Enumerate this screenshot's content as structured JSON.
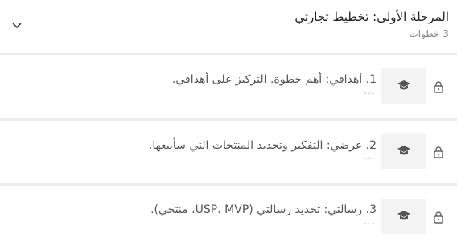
{
  "module": {
    "title": "المرحلة الأولى: تخطيط تجارتي",
    "steps_count": "3 خطوات"
  },
  "steps": [
    {
      "title": "1. أهدافي: أهم خطوة. التركيز على أهدافي.",
      "meta": "---",
      "icon": "graduation-cap-icon",
      "status_icon": "lock-icon"
    },
    {
      "title": "2. عرضي: التفكير وتحديد المنتجات التي سأبيعها.",
      "meta": "---",
      "icon": "graduation-cap-icon",
      "status_icon": "lock-icon"
    },
    {
      "title": "3. رسالتي: تحديد رسالتي (USP، MVP، منتجي).",
      "meta": "---",
      "icon": "graduation-cap-icon",
      "status_icon": "lock-icon"
    }
  ],
  "colors": {
    "separator": "#ececec",
    "thumb_bg": "#f3f3f3",
    "text": "#555555"
  }
}
